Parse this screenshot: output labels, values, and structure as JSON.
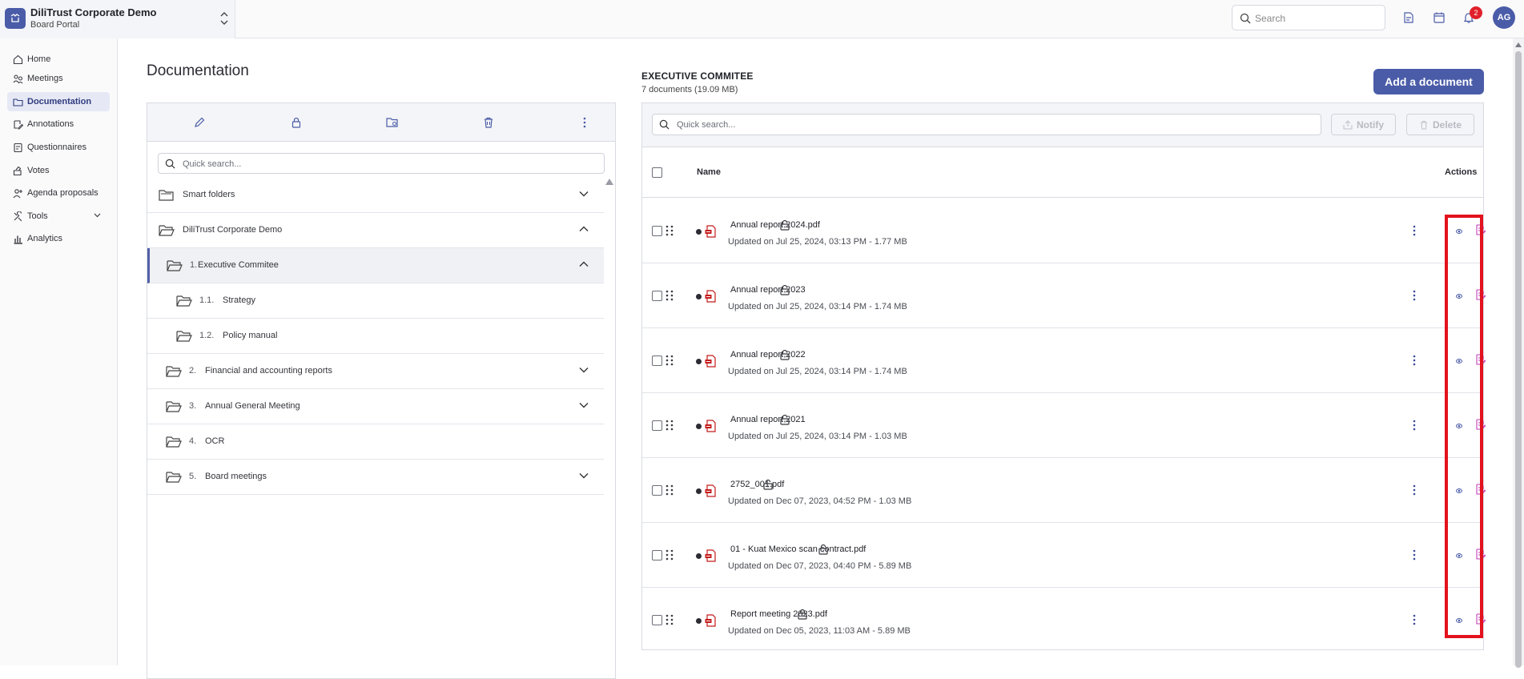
{
  "brand": {
    "title": "DiliTrust Corporate Demo",
    "subtitle": "Board Portal"
  },
  "topbar": {
    "search_placeholder": "Search",
    "notification_count": "2",
    "avatar_initials": "AG"
  },
  "sidebar": {
    "items": [
      {
        "label": "Home",
        "icon": "home-icon"
      },
      {
        "label": "Meetings",
        "icon": "meetings-icon"
      },
      {
        "label": "Documentation",
        "icon": "folder-icon",
        "active": true
      },
      {
        "label": "Annotations",
        "icon": "annotation-icon"
      },
      {
        "label": "Questionnaires",
        "icon": "questionnaire-icon"
      },
      {
        "label": "Votes",
        "icon": "vote-icon"
      },
      {
        "label": "Agenda proposals",
        "icon": "agenda-icon"
      },
      {
        "label": "Tools",
        "icon": "tools-icon",
        "expandable": true
      },
      {
        "label": "Analytics",
        "icon": "chart-icon"
      }
    ]
  },
  "page": {
    "title": "Documentation"
  },
  "tree": {
    "search_placeholder": "Quick search...",
    "toolbar_icons": [
      "edit-icon",
      "lock-icon",
      "folder-settings-icon",
      "trash-icon",
      "more-vertical-icon"
    ],
    "rows": [
      {
        "number": "",
        "label": "Smart folders",
        "expanded": false
      },
      {
        "number": "",
        "label": "DiliTrust Corporate Demo",
        "expanded": true
      },
      {
        "number": "1.",
        "label": "Executive Commitee",
        "expanded": true,
        "selected": true
      },
      {
        "number": "1.1.",
        "label": "Strategy"
      },
      {
        "number": "1.2.",
        "label": "Policy manual"
      },
      {
        "number": "2.",
        "label": "Financial and accounting reports",
        "expanded": false
      },
      {
        "number": "3.",
        "label": "Annual General Meeting",
        "expanded": false
      },
      {
        "number": "4.",
        "label": "OCR"
      },
      {
        "number": "5.",
        "label": "Board meetings",
        "expanded": false
      }
    ]
  },
  "docs": {
    "heading": "EXECUTIVE COMMITEE",
    "count": "7 documents (19.09 MB)",
    "add_label": "Add a document",
    "search_placeholder": "Quick search...",
    "notify_label": "Notify",
    "delete_label": "Delete",
    "col_name": "Name",
    "col_actions": "Actions",
    "rows": [
      {
        "name": "Annual report 2024.pdf",
        "meta": "Updated on Jul 25, 2024, 03:13 PM - 1.77 MB",
        "locked": false
      },
      {
        "name": "Annual report 2023",
        "meta": "Updated on Jul 25, 2024, 03:14 PM - 1.74 MB",
        "locked": false
      },
      {
        "name": "Annual report 2022",
        "meta": "Updated on Jul 25, 2024, 03:14 PM - 1.74 MB",
        "locked": false
      },
      {
        "name": "Annual report 2021",
        "meta": "Updated on Jul 25, 2024, 03:14 PM - 1.03 MB",
        "locked": false
      },
      {
        "name": "2752_001.pdf",
        "meta": "Updated on Dec 07, 2023, 04:52 PM - 1.03 MB",
        "locked": false
      },
      {
        "name": "01 - Kuat Mexico scan contract.pdf",
        "meta": "Updated on Dec 07, 2023, 04:40 PM - 5.89 MB",
        "locked": false
      },
      {
        "name": "Report meeting 2023.pdf",
        "meta": "Updated on Dec 05, 2023, 11:03 AM - 5.89 MB",
        "locked": true
      }
    ]
  },
  "colors": {
    "accent": "#4a5ca8",
    "highlight": "#e3121c",
    "sign_icon": "#c23fb8",
    "badge": "#e0212b"
  }
}
